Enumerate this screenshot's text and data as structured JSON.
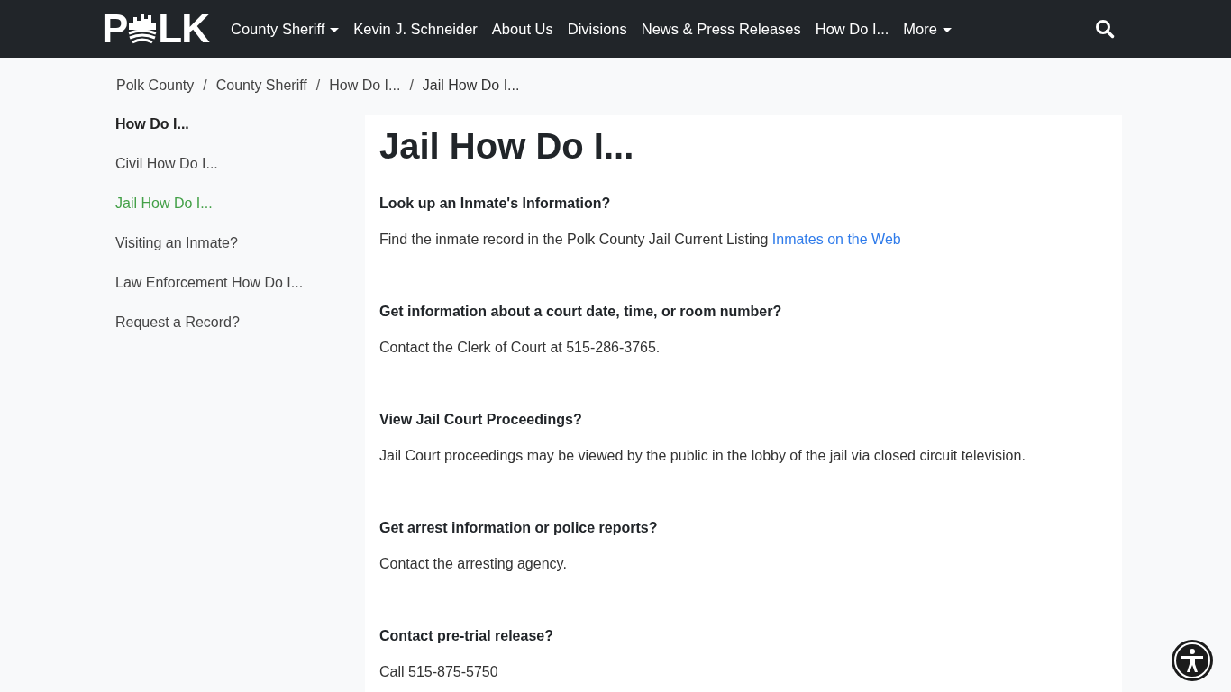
{
  "logo": {
    "before": "P",
    "after": "LK"
  },
  "nav": [
    {
      "label": "County Sheriff",
      "dropdown": true
    },
    {
      "label": "Kevin J. Schneider",
      "dropdown": false
    },
    {
      "label": "About Us",
      "dropdown": false
    },
    {
      "label": "Divisions",
      "dropdown": false
    },
    {
      "label": "News & Press Releases",
      "dropdown": false
    },
    {
      "label": "How Do I...",
      "dropdown": false
    },
    {
      "label": "More",
      "dropdown": true
    }
  ],
  "breadcrumb_separator": "/",
  "breadcrumb": [
    "Polk County",
    "County Sheriff",
    "How Do I...",
    "Jail How Do I..."
  ],
  "sidebar": [
    {
      "label": "How Do I...",
      "kind": "heading",
      "selected": false
    },
    {
      "label": "Civil How Do I...",
      "kind": "link",
      "selected": false
    },
    {
      "label": "Jail How Do I...",
      "kind": "link",
      "selected": true
    },
    {
      "label": "Visiting an Inmate?",
      "kind": "link",
      "selected": false
    },
    {
      "label": "Law Enforcement How Do I...",
      "kind": "link",
      "selected": false
    },
    {
      "label": "Request a Record?",
      "kind": "link",
      "selected": false
    }
  ],
  "title": "Jail How Do I...",
  "sections": [
    {
      "question": "Look up an Inmate's Information?",
      "answer": "Find the inmate record in the Polk County Jail Current Listing",
      "link": "Inmates on the Web"
    },
    {
      "question": "Get information about a court date, time, or room number?",
      "answer": "Contact the Clerk of Court at 515-286-3765."
    },
    {
      "question": "View Jail Court Proceedings?",
      "answer": "Jail Court proceedings may be viewed by the public in the lobby of the jail via closed circuit television."
    },
    {
      "question": "Get arrest information or police reports?",
      "answer": "Contact the arresting agency."
    },
    {
      "question": "Contact pre-trial release?",
      "answer": "Call 515-875-5750"
    }
  ]
}
